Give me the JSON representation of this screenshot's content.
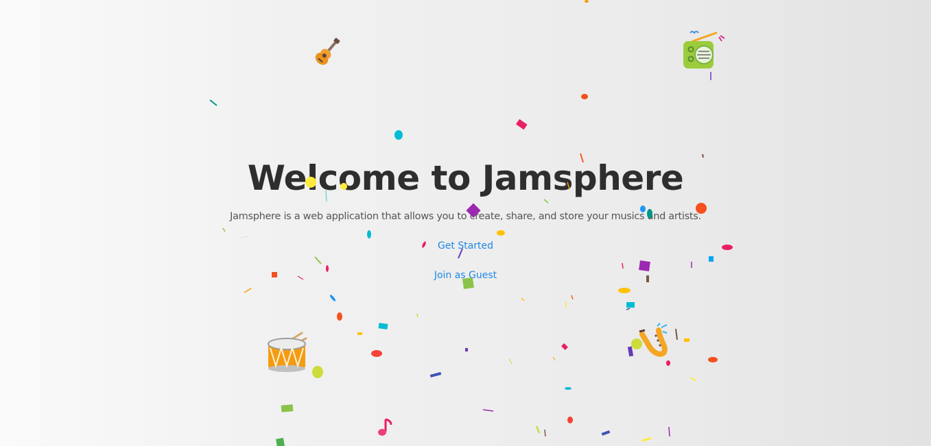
{
  "hero": {
    "title": "Welcome to Jamsphere",
    "subtitle": "Jamsphere is a web application that allows you to create, share, and store your musics and artists."
  },
  "actions": {
    "get_started": "Get Started",
    "guest": "Join as Guest"
  },
  "colors": {
    "title": "#2e2e2e",
    "subtitle": "#555555",
    "link": "#1e88e5",
    "background": "#efefef"
  },
  "decorations": {
    "icons": [
      "guitar-icon",
      "radio-icon",
      "drum-icon",
      "saxophone-icon",
      "music-note-icon"
    ]
  }
}
